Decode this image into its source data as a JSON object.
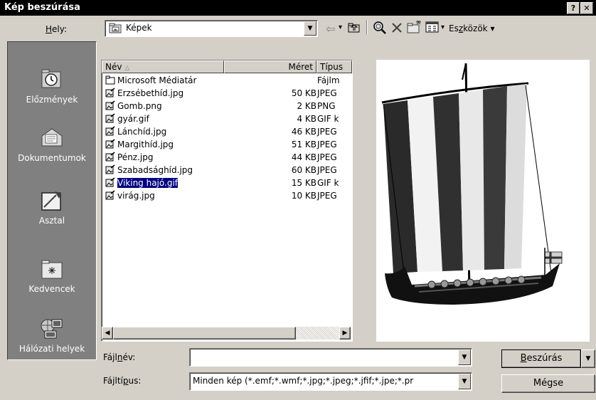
{
  "window": {
    "title": "Kép beszúrása",
    "help": "?",
    "close": "✕"
  },
  "location": {
    "label_pre": "",
    "label_u": "H",
    "label_post": "ely:",
    "value": "Képek"
  },
  "toolbar": {
    "tools_pre": "Es",
    "tools_u": "z",
    "tools_post": "közök",
    "dropdown_arrow": "▾",
    "back_arrow": "⇦"
  },
  "places": [
    {
      "label": "Előzmények",
      "icon": "history-icon"
    },
    {
      "label": "Dokumentumok",
      "icon": "documents-icon"
    },
    {
      "label": "Asztal",
      "icon": "desktop-icon"
    },
    {
      "label": "Kedvencek",
      "icon": "favorites-icon"
    },
    {
      "label": "Hálózati helyek",
      "icon": "network-places-icon"
    }
  ],
  "file_list": {
    "columns": [
      "Név",
      "Méret",
      "Típus"
    ],
    "rows": [
      {
        "name": "Microsoft Médiatár",
        "size": "",
        "type": "Fájlm",
        "kind": "folder"
      },
      {
        "name": "Erzsébethíd.jpg",
        "size": "50 KB",
        "type": "JPEG",
        "kind": "image"
      },
      {
        "name": "Gomb.png",
        "size": "2 KB",
        "type": "PNG",
        "kind": "image"
      },
      {
        "name": "gyár.gif",
        "size": "4 KB",
        "type": "GIF k",
        "kind": "image"
      },
      {
        "name": "Lánchíd.jpg",
        "size": "46 KB",
        "type": "JPEG",
        "kind": "image"
      },
      {
        "name": "Margithíd.jpg",
        "size": "51 KB",
        "type": "JPEG",
        "kind": "image"
      },
      {
        "name": "Pénz.jpg",
        "size": "44 KB",
        "type": "JPEG",
        "kind": "image"
      },
      {
        "name": "Szabadsághíd.jpg",
        "size": "60 KB",
        "type": "JPEG",
        "kind": "image"
      },
      {
        "name": "Viking hajó.gif",
        "size": "15 KB",
        "type": "GIF k",
        "kind": "image",
        "selected": true
      },
      {
        "name": "virág.jpg",
        "size": "10 KB",
        "type": "JPEG",
        "kind": "image"
      }
    ]
  },
  "filename": {
    "label_pre": "Fájl",
    "label_u": "n",
    "label_post": "év:",
    "value": ""
  },
  "filetype": {
    "label_pre": "Fájltí",
    "label_u": "p",
    "label_post": "us:",
    "value": "Minden kép (*.emf;*.wmf;*.jpg;*.jpeg;*.jfif;*.jpe;*.pr"
  },
  "buttons": {
    "insert_u": "B",
    "insert_post": "eszúrás",
    "cancel": "Mégse"
  },
  "colors": {
    "title_bar": "#000000",
    "face": "#d4d0c8",
    "places_bg": "#808080",
    "selection": "#000080"
  }
}
